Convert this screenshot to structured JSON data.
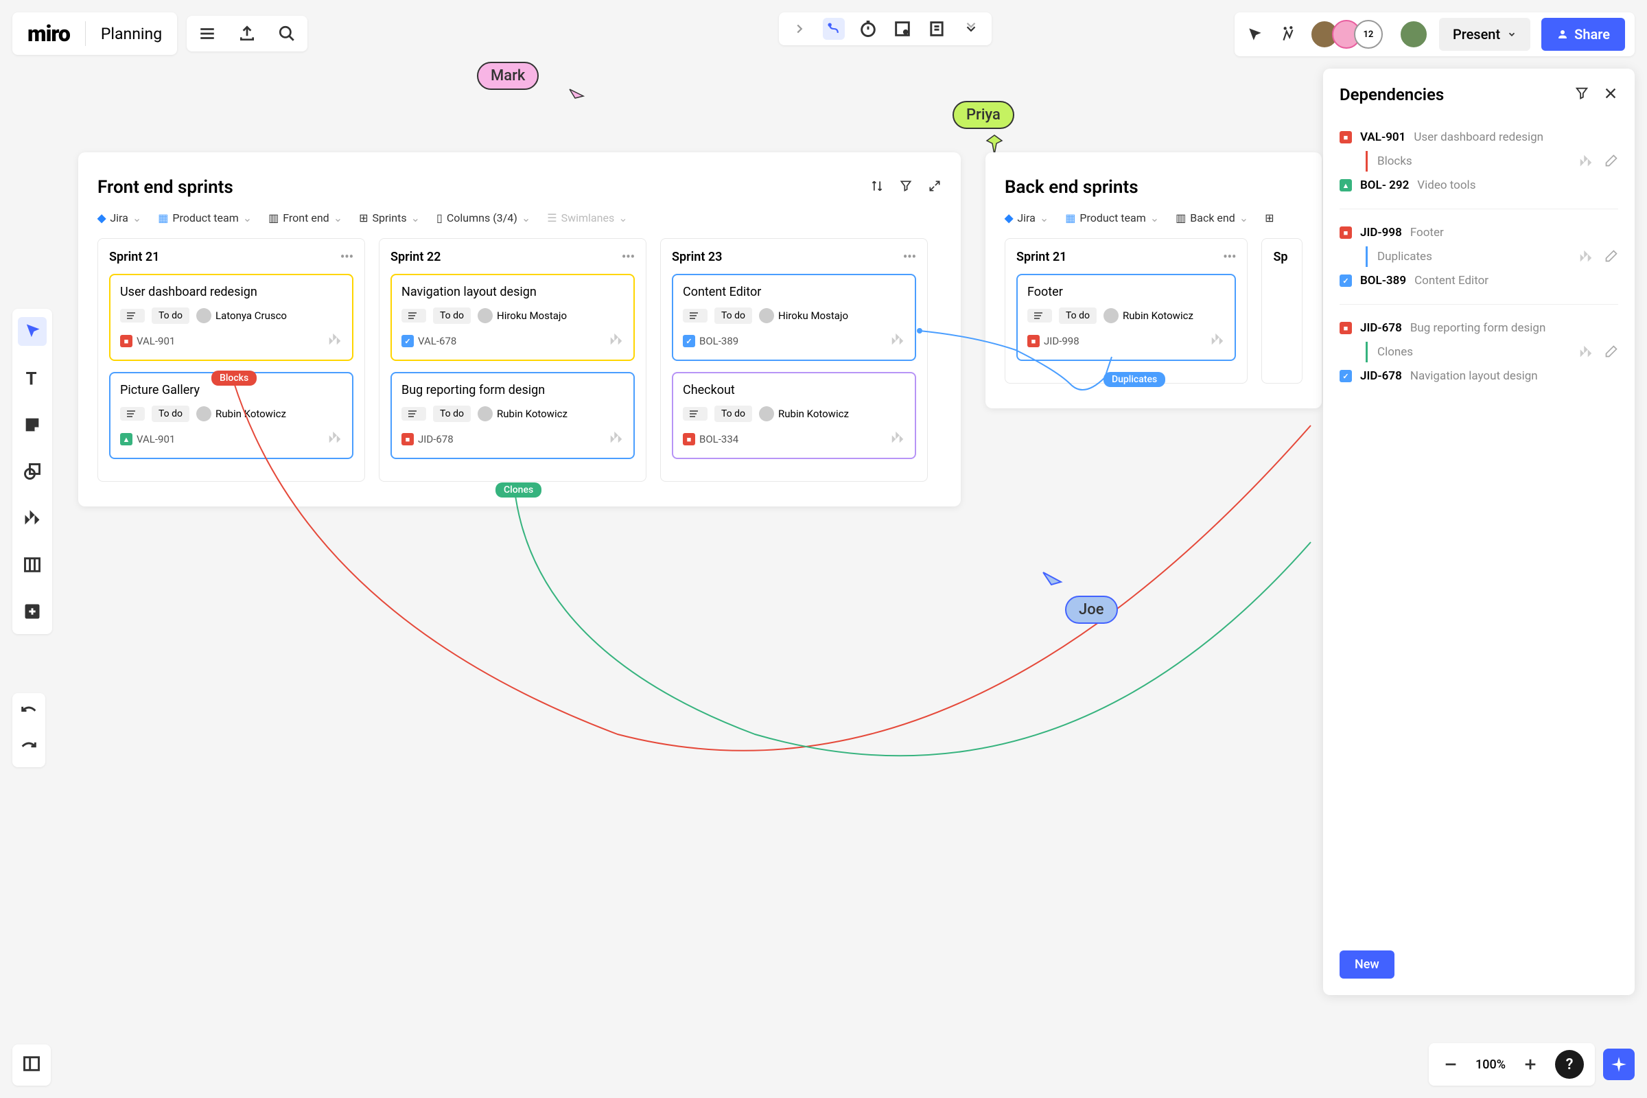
{
  "app": {
    "logo": "miro",
    "board_name": "Planning"
  },
  "collaborators": {
    "count": "12",
    "cursors": {
      "mark": "Mark",
      "priya": "Priya",
      "joe": "Joe"
    }
  },
  "actions": {
    "present": "Present",
    "share": "Share"
  },
  "zoom": {
    "level": "100%"
  },
  "frames": {
    "frontend": {
      "title": "Front end sprints",
      "filters": {
        "source": "Jira",
        "team": "Product team",
        "view": "Front end",
        "group": "Sprints",
        "columns": "Columns (3/4)",
        "swimlanes": "Swimlanes"
      },
      "columns": [
        {
          "name": "Sprint 21",
          "cards": [
            {
              "title": "User dashboard redesign",
              "status": "To do",
              "assignee": "Latonya Crusco",
              "ticket": "VAL-901",
              "ticket_type": "red",
              "border": "yellow"
            },
            {
              "title": "Picture Gallery",
              "status": "To do",
              "assignee": "Rubin Kotowicz",
              "ticket": "VAL-901",
              "ticket_type": "green",
              "border": "blue"
            }
          ]
        },
        {
          "name": "Sprint 22",
          "cards": [
            {
              "title": "Navigation layout design",
              "status": "To do",
              "assignee": "Hiroku Mostajo",
              "ticket": "VAL-678",
              "ticket_type": "blue",
              "border": "yellow"
            },
            {
              "title": "Bug reporting form design",
              "status": "To do",
              "assignee": "Rubin Kotowicz",
              "ticket": "JID-678",
              "ticket_type": "red",
              "border": "blue"
            }
          ]
        },
        {
          "name": "Sprint 23",
          "cards": [
            {
              "title": "Content Editor",
              "status": "To do",
              "assignee": "Hiroku Mostajo",
              "ticket": "BOL-389",
              "ticket_type": "blue",
              "border": "blue"
            },
            {
              "title": "Checkout",
              "status": "To do",
              "assignee": "Rubin Kotowicz",
              "ticket": "BOL-334",
              "ticket_type": "red",
              "border": "purple"
            }
          ]
        }
      ]
    },
    "backend": {
      "title": "Back end sprints",
      "filters": {
        "source": "Jira",
        "team": "Product team",
        "view": "Back end"
      },
      "columns": [
        {
          "name": "Sprint 21",
          "cards": [
            {
              "title": "Footer",
              "status": "To do",
              "assignee": "Rubin Kotowicz",
              "ticket": "JID-998",
              "ticket_type": "red",
              "border": "blue"
            }
          ]
        },
        {
          "name_partial": "Sp"
        }
      ]
    }
  },
  "dep_labels": {
    "blocks": "Blocks",
    "clones": "Clones",
    "duplicates": "Duplicates"
  },
  "deps_panel": {
    "title": "Dependencies",
    "new_btn": "New",
    "items": [
      {
        "from_ticket": "VAL-901",
        "from_name": "User dashboard redesign",
        "from_type": "red",
        "type": "Blocks",
        "arrow_color": "#e5493a",
        "to_ticket": "BOL- 292",
        "to_name": "Video tools",
        "to_type": "green"
      },
      {
        "from_ticket": "JID-998",
        "from_name": "Footer",
        "from_type": "red",
        "type": "Duplicates",
        "arrow_color": "#4a9eff",
        "to_ticket": "BOL-389",
        "to_name": "Content Editor",
        "to_type": "blue"
      },
      {
        "from_ticket": "JID-678",
        "from_name": "Bug reporting form design",
        "from_type": "red",
        "type": "Clones",
        "arrow_color": "#36b37e",
        "to_ticket": "JID-678",
        "to_name": "Navigation layout design",
        "to_type": "blue"
      }
    ]
  }
}
